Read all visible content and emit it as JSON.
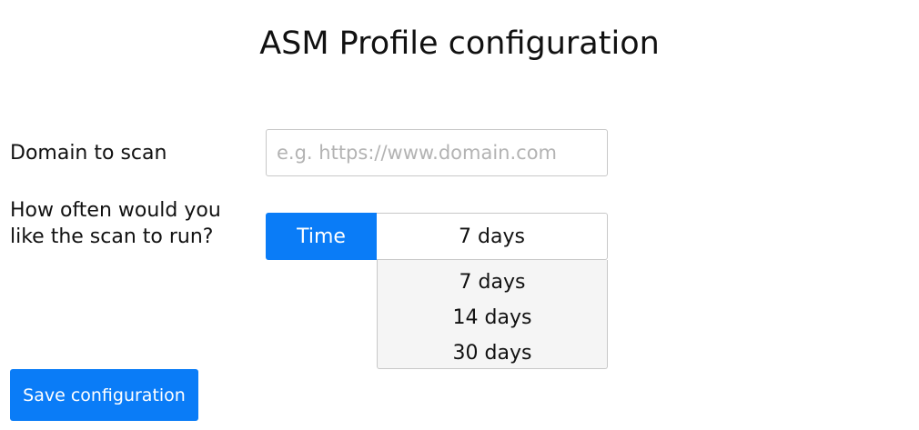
{
  "page": {
    "title": "ASM Profile configuration"
  },
  "form": {
    "domain_label": "Domain to scan",
    "domain_value": "",
    "domain_placeholder": "e.g. https://www.domain.com",
    "frequency_label": "How often would you like the scan to run?",
    "time_addon_label": "Time",
    "frequency_selected": "7 days",
    "frequency_options": [
      "7 days",
      "14 days",
      "30 days"
    ],
    "save_label": "Save configuration"
  },
  "colors": {
    "accent": "#0a7cf7",
    "dropdown_background": "#f5f5f5",
    "border": "#c8c8c8",
    "placeholder": "#b3b3b3"
  }
}
